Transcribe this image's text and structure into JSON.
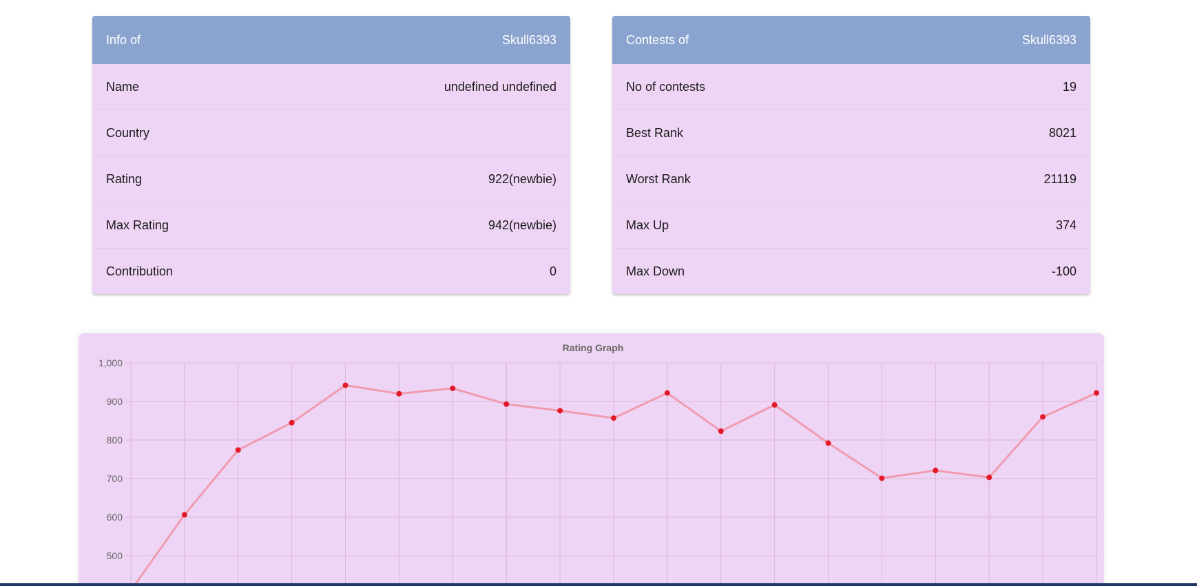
{
  "colors": {
    "header_bg": "#8aa4cf",
    "card_bg": "#efd5f5",
    "graph_bg": "#efd5f5",
    "line": "#ef9bb0",
    "point": "#e3192a",
    "grid": "#d8b6d9",
    "axis_text": "#666666",
    "bottom_bar": "#1f3566"
  },
  "info_card": {
    "header_label": "Info of",
    "header_value": "Skull6393",
    "rows": [
      {
        "label": "Name",
        "value": "undefined undefined"
      },
      {
        "label": "Country",
        "value": ""
      },
      {
        "label": "Rating",
        "value": "922(newbie)"
      },
      {
        "label": "Max Rating",
        "value": "942(newbie)"
      },
      {
        "label": "Contribution",
        "value": "0"
      }
    ]
  },
  "contests_card": {
    "header_label": "Contests of",
    "header_value": "Skull6393",
    "rows": [
      {
        "label": "No of contests",
        "value": "19"
      },
      {
        "label": "Best Rank",
        "value": "8021"
      },
      {
        "label": "Worst Rank",
        "value": "21119"
      },
      {
        "label": "Max Up",
        "value": "374"
      },
      {
        "label": "Max Down",
        "value": "-100"
      }
    ]
  },
  "chart_data": {
    "type": "line",
    "title": "Rating Graph",
    "xlabel": "",
    "ylabel": "",
    "ylim": [
      400,
      1000
    ],
    "y_ticks": [
      "1,000",
      "900",
      "800",
      "700",
      "600",
      "500"
    ],
    "y_tick_values": [
      1000,
      900,
      800,
      700,
      600,
      500
    ],
    "grid": true,
    "x": [
      1,
      2,
      3,
      4,
      5,
      6,
      7,
      8,
      9,
      10,
      11,
      12,
      13,
      14,
      15,
      16,
      17,
      18,
      19
    ],
    "values": [
      410,
      606,
      774,
      845,
      942,
      920,
      934,
      893,
      876,
      857,
      922,
      823,
      891,
      792,
      701,
      721,
      703,
      860,
      922
    ]
  }
}
